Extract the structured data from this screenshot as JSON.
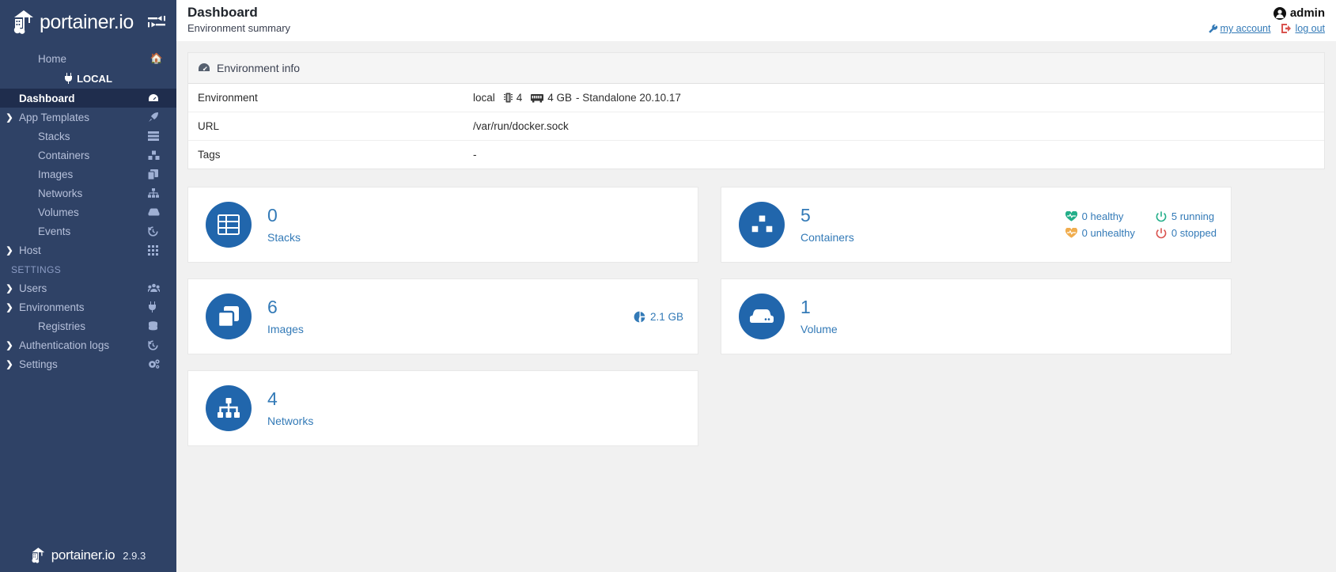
{
  "brand": {
    "name": "portainer.io",
    "logo_icon": "portainer-crane-logo",
    "toggle_icon": "collapse-sidebar-icon",
    "footer_name": "portainer.io",
    "version": "2.9.3"
  },
  "sidebar": {
    "home": {
      "label": "Home",
      "icon": "home-icon"
    },
    "environment_badge": {
      "label": "LOCAL",
      "icon": "plug-icon"
    },
    "items": [
      {
        "label": "Dashboard",
        "icon": "dashboard-icon",
        "caret": false,
        "active": true
      },
      {
        "label": "App Templates",
        "icon": "rocket-icon",
        "caret": true,
        "active": false
      },
      {
        "label": "Stacks",
        "icon": "stacks-icon",
        "caret": false,
        "active": false
      },
      {
        "label": "Containers",
        "icon": "containers-icon",
        "caret": false,
        "active": false
      },
      {
        "label": "Images",
        "icon": "images-icon",
        "caret": false,
        "active": false
      },
      {
        "label": "Networks",
        "icon": "networks-icon",
        "caret": false,
        "active": false
      },
      {
        "label": "Volumes",
        "icon": "volume-icon",
        "caret": false,
        "active": false
      },
      {
        "label": "Events",
        "icon": "history-icon",
        "caret": false,
        "active": false
      },
      {
        "label": "Host",
        "icon": "grid-icon",
        "caret": true,
        "active": false
      }
    ],
    "section_label": "SETTINGS",
    "settings_items": [
      {
        "label": "Users",
        "icon": "users-icon",
        "caret": true
      },
      {
        "label": "Environments",
        "icon": "plug-icon",
        "caret": true
      },
      {
        "label": "Registries",
        "icon": "database-icon",
        "caret": false
      },
      {
        "label": "Authentication logs",
        "icon": "history-icon",
        "caret": true
      },
      {
        "label": "Settings",
        "icon": "gears-icon",
        "caret": true
      }
    ]
  },
  "header": {
    "title": "Dashboard",
    "subtitle": "Environment summary",
    "user": {
      "name": "admin",
      "icon": "user-circle-icon"
    },
    "my_account": {
      "label": "my account",
      "icon": "wrench-icon"
    },
    "log_out": {
      "label": "log out",
      "icon": "sign-out-icon"
    }
  },
  "environment_info": {
    "panel_title": "Environment info",
    "panel_icon": "dashboard-icon",
    "rows": [
      {
        "key": "Environment",
        "value": "local",
        "cpu": "4",
        "cpu_icon": "cpu-icon",
        "memory": "4 GB",
        "memory_icon": "memory-icon",
        "suffix": "- Standalone 20.10.17"
      },
      {
        "key": "URL",
        "value": "/var/run/docker.sock"
      },
      {
        "key": "Tags",
        "value": "-"
      }
    ]
  },
  "widgets": {
    "stacks": {
      "count": "0",
      "label": "Stacks",
      "icon": "stacks-icon"
    },
    "containers": {
      "count": "5",
      "label": "Containers",
      "icon": "containers-icon",
      "healthy": {
        "value": "0 healthy",
        "icon": "heartbeat-icon",
        "color": "#23ae89"
      },
      "unhealthy": {
        "value": "0 unhealthy",
        "icon": "heartbeat-icon",
        "color": "#f0ad4e"
      },
      "running": {
        "value": "5 running",
        "icon": "power-icon",
        "color": "#23ae89"
      },
      "stopped": {
        "value": "0 stopped",
        "icon": "power-icon",
        "color": "#d9534f"
      }
    },
    "images": {
      "count": "6",
      "label": "Images",
      "icon": "images-icon",
      "size": "2.1 GB",
      "size_icon": "pie-chart-icon"
    },
    "volumes": {
      "count": "1",
      "label": "Volume",
      "icon": "volume-icon"
    },
    "networks": {
      "count": "4",
      "label": "Networks",
      "icon": "networks-icon"
    }
  },
  "colors": {
    "sidebar_bg": "#2f4266",
    "sidebar_active_bg": "#1f2d4d",
    "accent_blue": "#337ab7",
    "circle_blue": "#2166ac",
    "page_bg": "#f1f1f1"
  }
}
